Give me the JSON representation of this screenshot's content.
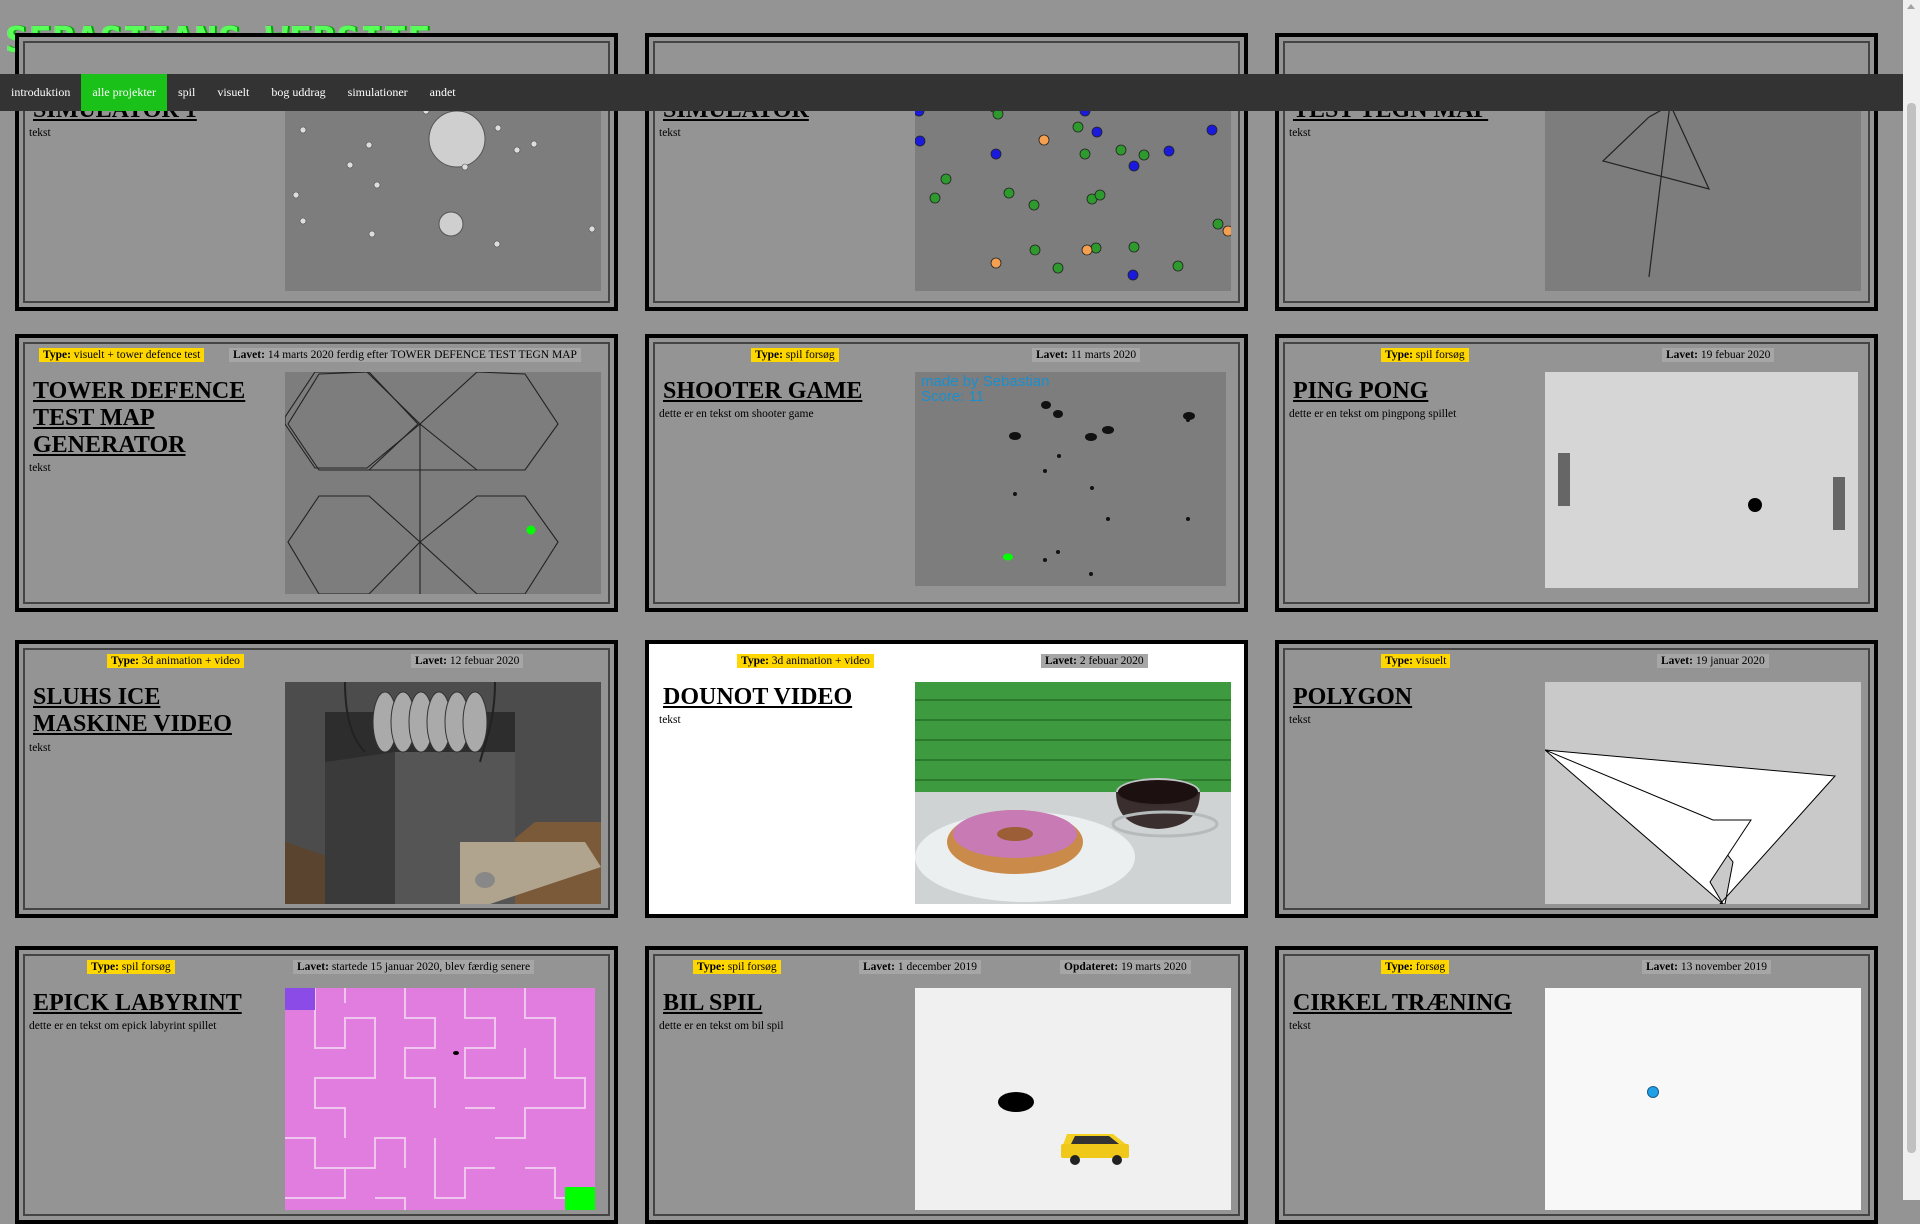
{
  "site": {
    "logo_text": "SEBASTIANS WEBSITE"
  },
  "nav": {
    "items": [
      {
        "label": "introduktion",
        "active": false
      },
      {
        "label": "alle projekter",
        "active": true
      },
      {
        "label": "spil",
        "active": false
      },
      {
        "label": "visuelt",
        "active": false
      },
      {
        "label": "bog uddrag",
        "active": false
      },
      {
        "label": "simulationer",
        "active": false
      },
      {
        "label": "andet",
        "active": false
      }
    ],
    "active_color": "#19c119"
  },
  "cards": [
    {
      "title": "SIMULATOR 1",
      "text": "tekst"
    },
    {
      "title": "SIMULATOR",
      "text": "tekst"
    },
    {
      "title": "TEST TEGN MAP",
      "text": "tekst"
    },
    {
      "type_label": "Type:",
      "type": "visuelt + tower defence test",
      "date_label": "Lavet:",
      "date": "14 marts 2020 ferdig efter TOWER DEFENCE TEST TEGN MAP",
      "title": "TOWER DEFENCE TEST MAP GENERATOR",
      "text": "tekst"
    },
    {
      "type_label": "Type:",
      "type": "spil forsøg",
      "date_label": "Lavet:",
      "date": "11 marts 2020",
      "title": "SHOOTER GAME",
      "text": "dette er en tekst om shooter game",
      "thumb_text_1": "made by Sebastian",
      "thumb_text_2": "Score: 11"
    },
    {
      "type_label": "Type:",
      "type": "spil forsøg",
      "date_label": "Lavet:",
      "date": "19 febuar 2020",
      "title": "PING PONG",
      "text": "dette er en tekst om pingpong spillet"
    },
    {
      "type_label": "Type:",
      "type": "3d animation + video",
      "date_label": "Lavet:",
      "date": "12 febuar 2020",
      "title": "SLUHS ICE MASKINE VIDEO",
      "text": "tekst"
    },
    {
      "type_label": "Type:",
      "type": "3d animation + video",
      "date_label": "Lavet:",
      "date": "2 febuar 2020",
      "title": "DOUNOT VIDEO",
      "text": "tekst"
    },
    {
      "type_label": "Type:",
      "type": "visuelt",
      "date_label": "Lavet:",
      "date": "19 januar 2020",
      "title": "POLYGON",
      "text": "tekst"
    },
    {
      "type_label": "Type:",
      "type": "spil forsøg",
      "date_label": "Lavet:",
      "date": "startede 15 januar 2020, blev færdig senere",
      "title": "EPICK LABYRINT",
      "text": "dette er en tekst om epick labyrint spillet"
    },
    {
      "type_label": "Type:",
      "type": "spil forsøg",
      "date_label": "Lavet:",
      "date": "1 december 2019",
      "updated_label": "Opdateret:",
      "updated": "19 marts 2020",
      "title": "BIL SPIL",
      "text": "dette er en tekst om bil spil"
    },
    {
      "type_label": "Type:",
      "type": "forsøg",
      "date_label": "Lavet:",
      "date": "13 november 2019",
      "title": "CIRKEL TRÆNING",
      "text": "tekst"
    }
  ],
  "colors": {
    "type_badge": "#ffd700",
    "date_badge": "#a6a6a6",
    "page_bg": "#949494",
    "nav_bg": "#333333"
  }
}
